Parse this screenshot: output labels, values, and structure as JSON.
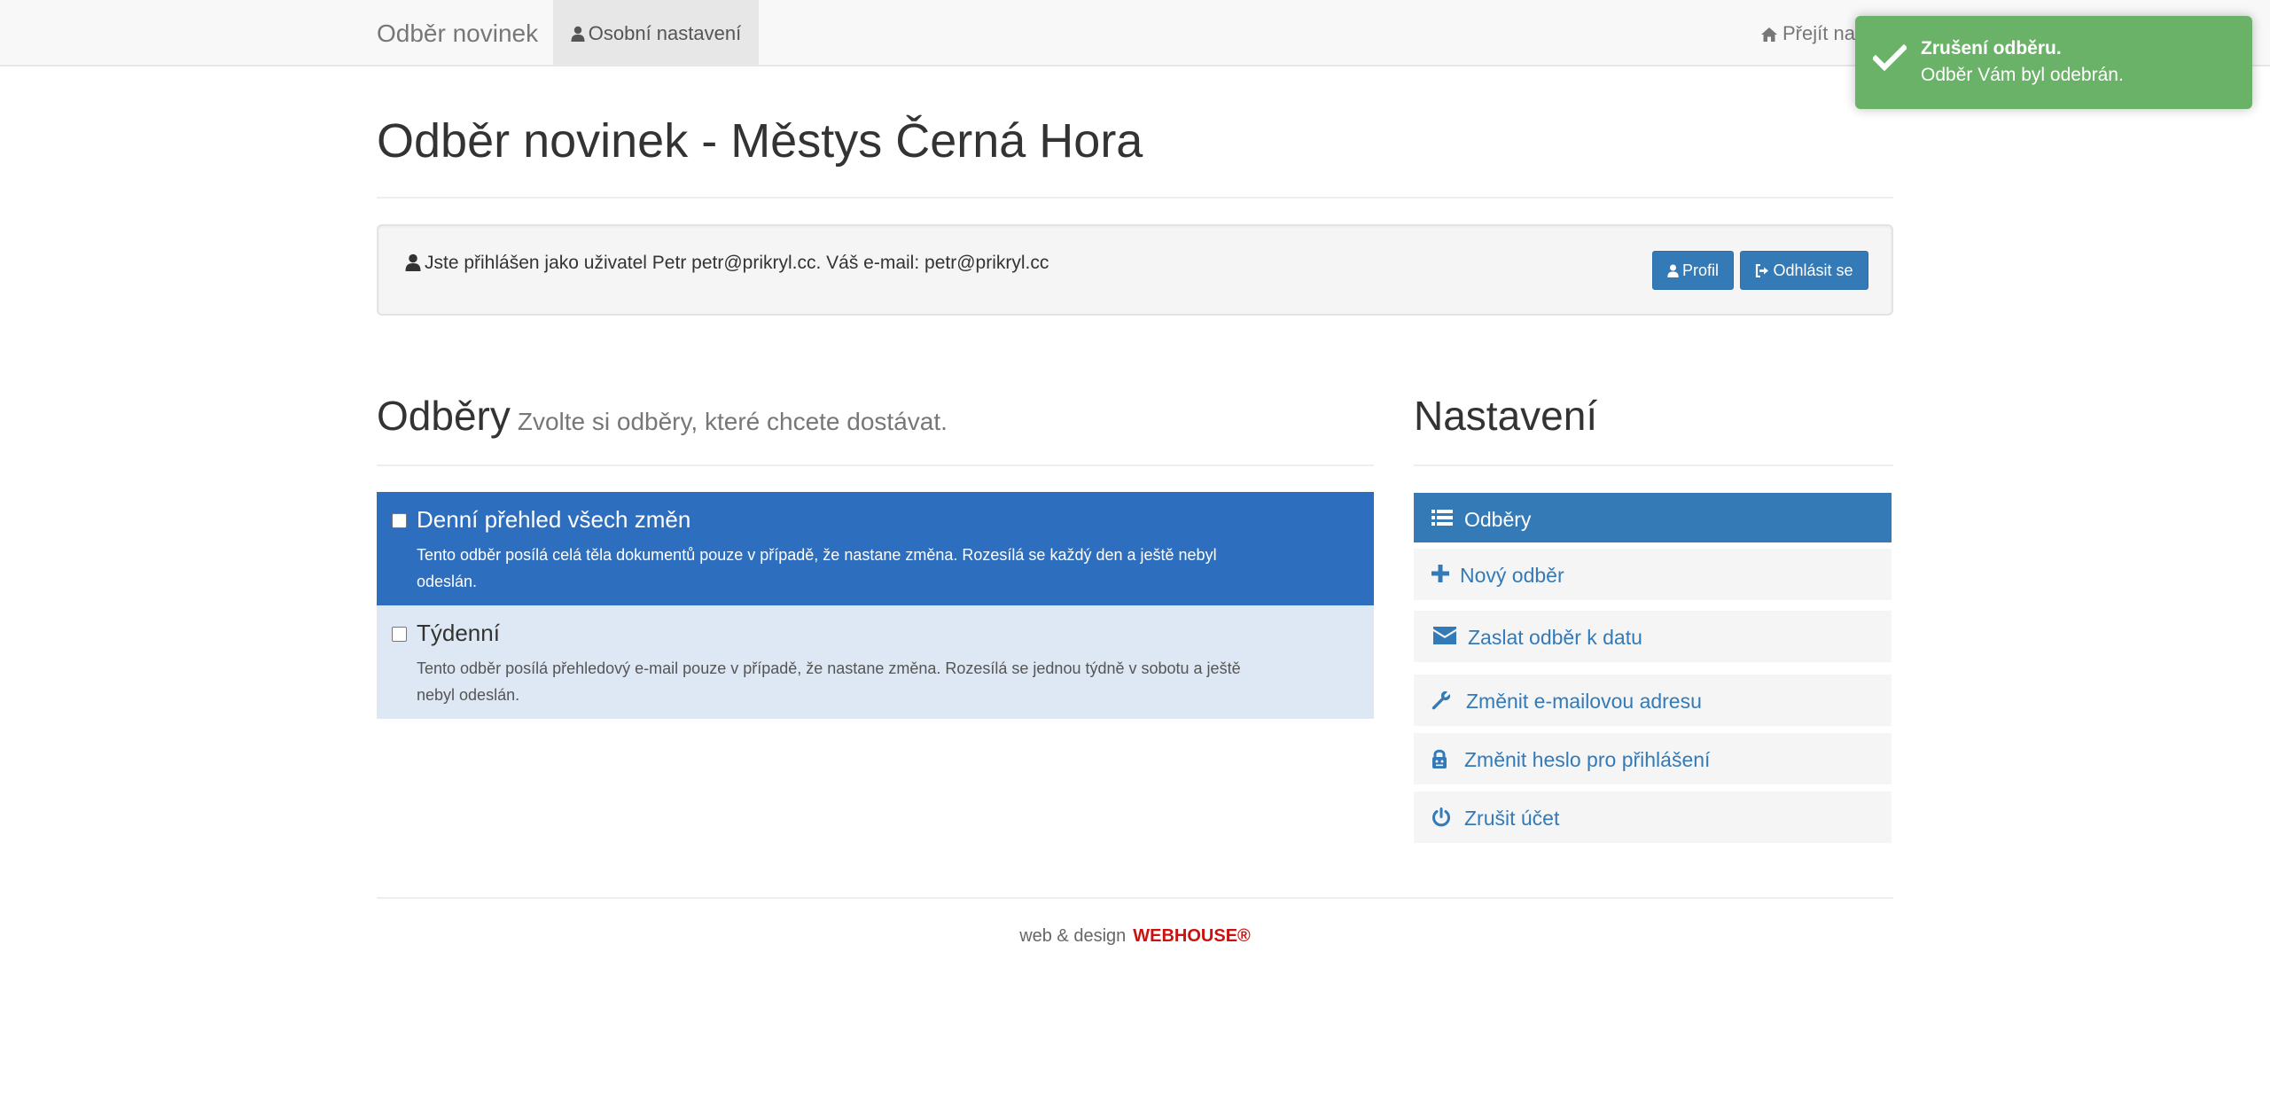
{
  "navbar": {
    "brand": "Odběr novinek",
    "personal_settings": "Osobní nastavení",
    "go_to_web": "Přejít na web"
  },
  "toast": {
    "title": "Zrušení odběru.",
    "message": "Odběr Vám byl odebrán.",
    "color": "#6ab268"
  },
  "page": {
    "title": "Odběr novinek - Městys Černá Hora"
  },
  "user_panel": {
    "text": "Jste přihlášen jako uživatel Petr petr@prikryl.cc. Váš e-mail: petr@prikryl.cc",
    "profile_button": "Profil",
    "logout_button": "Odhlásit se"
  },
  "subscriptions": {
    "heading": "Odběry",
    "subheading": "Zvolte si odběry, které chcete dostávat.",
    "items": [
      {
        "title": "Denní přehled všech změn",
        "description": "Tento odběr posílá celá těla dokumentů pouze v případě, že nastane změna. Rozesílá se každý den a ještě nebyl odeslán.",
        "checked": false,
        "active": true
      },
      {
        "title": "Týdenní",
        "description": "Tento odběr posílá přehledový e-mail pouze v případě, že nastane změna. Rozesílá se jednou týdně v sobotu a ještě nebyl odeslán.",
        "checked": false,
        "active": false
      }
    ]
  },
  "settings": {
    "heading": "Nastavení",
    "items": [
      {
        "label": "Odběry",
        "icon": "list-icon",
        "active": true
      },
      {
        "label": "Nový odběr",
        "icon": "plus-icon",
        "active": false
      },
      {
        "label": "Zaslat odběr k datu",
        "icon": "envelope-icon",
        "active": false
      },
      {
        "label": "Změnit e-mailovou adresu",
        "icon": "wrench-icon",
        "active": false
      },
      {
        "label": "Změnit heslo pro přihlášení",
        "icon": "lock-icon",
        "active": false
      },
      {
        "label": "Zrušit účet",
        "icon": "power-icon",
        "active": false
      }
    ]
  },
  "footer": {
    "text": "web & design",
    "brand": "WEBHOUSE®"
  },
  "colors": {
    "primary": "#337ab7",
    "active_item": "#2d6ebe",
    "inactive_item": "#dde8f4",
    "footer_brand": "#cc1111"
  }
}
